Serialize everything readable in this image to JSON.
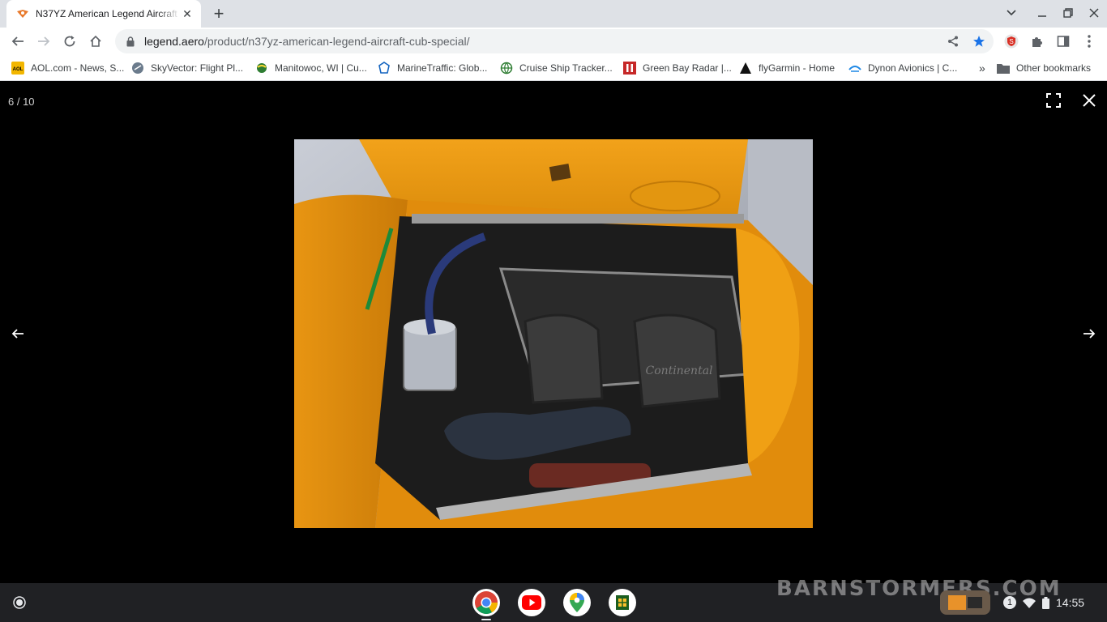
{
  "browser": {
    "tab_title": "N37YZ American Legend Aircraft Company",
    "url_host": "legend.aero",
    "url_path": "/product/n37yz-american-legend-aircraft-cub-special/"
  },
  "bookmarks": [
    {
      "label": "AOL.com - News, S...",
      "icon": "aol-icon"
    },
    {
      "label": "SkyVector: Flight Pl...",
      "icon": "skyvector-icon"
    },
    {
      "label": "Manitowoc, WI | Cu...",
      "icon": "globe-icon"
    },
    {
      "label": "MarineTraffic: Glob...",
      "icon": "marinetraffic-icon"
    },
    {
      "label": "Cruise Ship Tracker...",
      "icon": "globe-icon"
    },
    {
      "label": "Green Bay Radar |...",
      "icon": "radar-icon"
    },
    {
      "label": "flyGarmin - Home",
      "icon": "garmin-icon"
    },
    {
      "label": "Dynon Avionics | C...",
      "icon": "dynon-icon"
    }
  ],
  "bookmarks_overflow": "»",
  "other_bookmarks": "Other bookmarks",
  "viewer": {
    "counter": "6 / 10",
    "photo_alt": "Continental engine compartment with open cowling"
  },
  "shelf": {
    "watermark": "BARNSTORMERS.COM",
    "notification_count": "1",
    "time": "14:55"
  },
  "colors": {
    "tab_strip": "#dee1e6",
    "viewer_bg": "#000000",
    "shelf_bg": "#202124",
    "accent_blue": "#1a73e8"
  }
}
